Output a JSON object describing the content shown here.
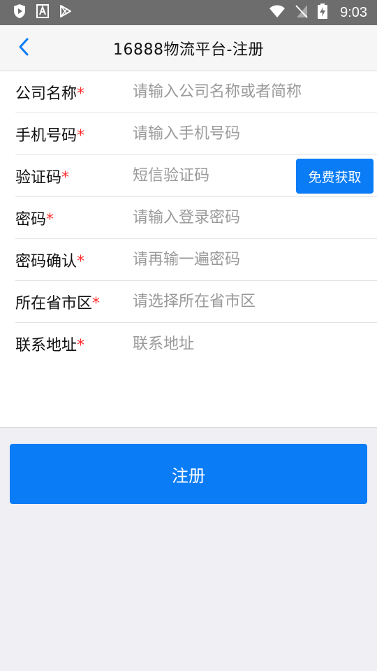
{
  "status_bar": {
    "time": "9:03",
    "icons": [
      "shield-play-icon",
      "font-a-icon",
      "play-store-icon",
      "wifi-icon",
      "no-sim-icon",
      "battery-charging-icon"
    ]
  },
  "nav": {
    "title": "16888物流平台-注册",
    "back_icon": "chevron-left-icon"
  },
  "colors": {
    "accent": "#0a7cf5",
    "required": "#ff2a2a",
    "placeholder": "#9a9a9a"
  },
  "form": {
    "company": {
      "label": "公司名称",
      "placeholder": "请输入公司名称或者简称",
      "value": ""
    },
    "phone": {
      "label": "手机号码",
      "placeholder": "请输入手机号码",
      "value": ""
    },
    "code": {
      "label": "验证码",
      "placeholder": "短信验证码",
      "value": "",
      "button_label": "免费获取"
    },
    "password": {
      "label": "密码",
      "placeholder": "请输入登录密码",
      "value": ""
    },
    "confirm": {
      "label": "密码确认",
      "placeholder": "请再输一遍密码",
      "value": ""
    },
    "region": {
      "label": "所在省市区",
      "placeholder": "请选择所在省市区",
      "value": ""
    },
    "address": {
      "label": "联系地址",
      "placeholder": "联系地址",
      "value": ""
    },
    "required_mark": "*"
  },
  "submit_label": "注册"
}
